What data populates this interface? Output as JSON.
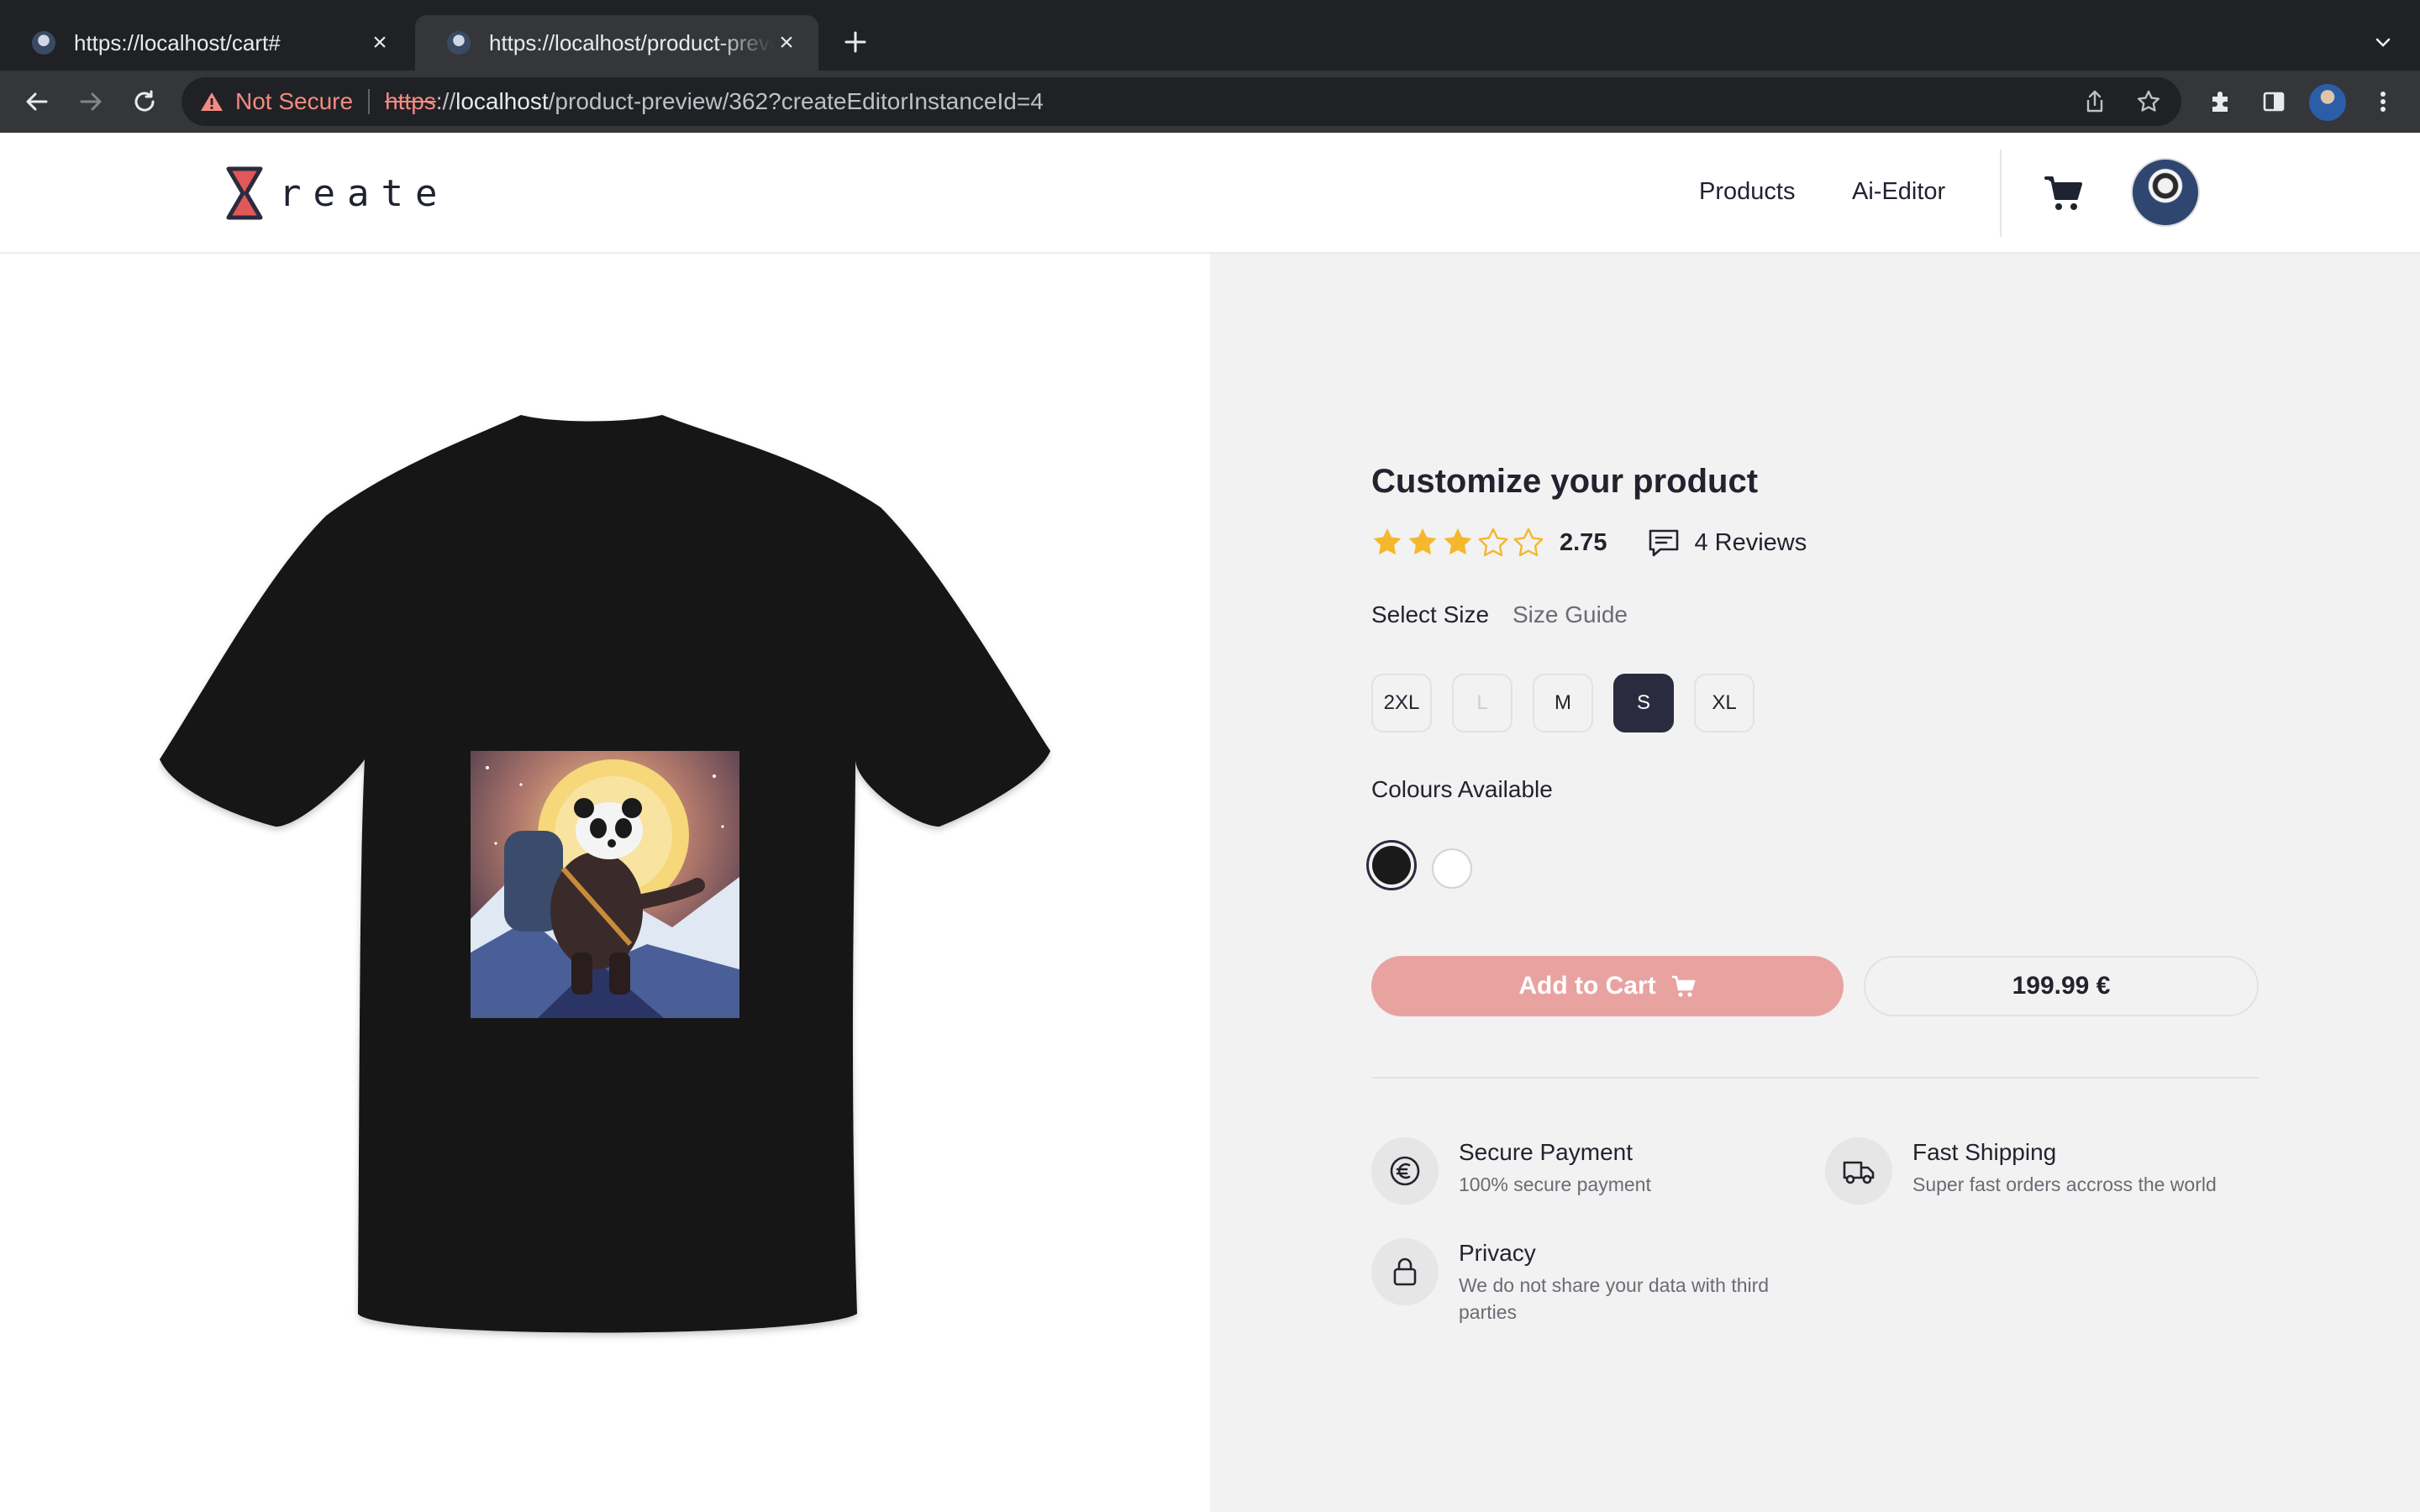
{
  "browser": {
    "tabs": [
      {
        "title": "https://localhost/cart#",
        "active": false
      },
      {
        "title": "https://localhost/product-preview/362?createEditorInstanceId=4",
        "active": true
      }
    ],
    "security_label": "Not Secure",
    "url_scheme": "https",
    "url_sep": "://",
    "url_host": "localhost",
    "url_path": "/product-preview/362?createEditorInstanceId=4"
  },
  "site": {
    "logo_text": "reate",
    "nav": [
      {
        "label": "Products"
      },
      {
        "label": "Ai-Editor"
      }
    ]
  },
  "product": {
    "heading": "Customize your product",
    "rating": 2.75,
    "rating_text": "2.75",
    "stars_filled": 3,
    "stars_total": 5,
    "reviews_text": "4 Reviews",
    "size_label": "Select Size",
    "size_guide_label": "Size Guide",
    "sizes": [
      {
        "label": "2XL",
        "state": "available"
      },
      {
        "label": "L",
        "state": "disabled"
      },
      {
        "label": "M",
        "state": "available"
      },
      {
        "label": "S",
        "state": "selected"
      },
      {
        "label": "XL",
        "state": "available"
      }
    ],
    "colours_label": "Colours Available",
    "colours": [
      {
        "name": "black",
        "hex": "#1a1a1a",
        "selected": true
      },
      {
        "name": "white",
        "hex": "#ffffff",
        "selected": false
      }
    ],
    "add_to_cart_label": "Add to Cart",
    "price": "199.99 €",
    "accent_color": "#e8a3a1",
    "selected_color": "#2b2b40"
  },
  "features": [
    {
      "icon": "euro-icon",
      "title": "Secure Payment",
      "subtitle": "100% secure payment"
    },
    {
      "icon": "truck-icon",
      "title": "Fast Shipping",
      "subtitle": "Super fast orders accross the world"
    },
    {
      "icon": "lock-icon",
      "title": "Privacy",
      "subtitle": "We do not share your data with third parties"
    }
  ]
}
